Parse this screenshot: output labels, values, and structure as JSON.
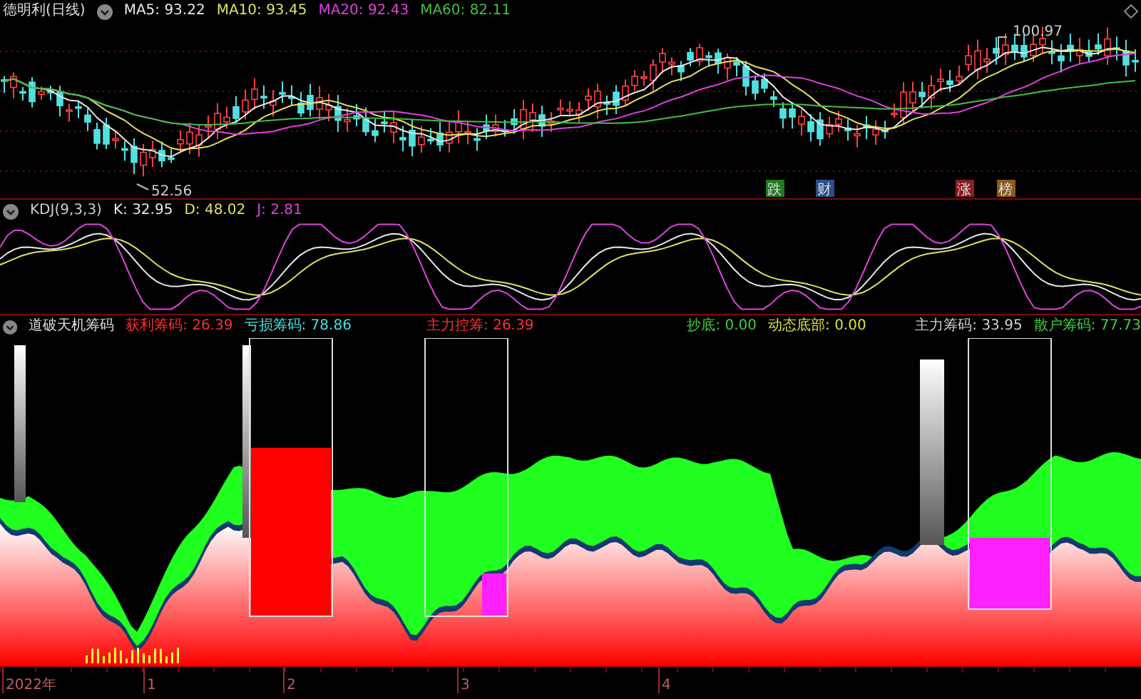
{
  "price_panel": {
    "title": "德明利(日线)",
    "indicators": [
      {
        "label": "MA5: 93.22",
        "color": "#e8e8e8"
      },
      {
        "label": "MA10: 93.45",
        "color": "#e0e060"
      },
      {
        "label": "MA20: 92.43",
        "color": "#e040e0"
      },
      {
        "label": "MA60: 82.11",
        "color": "#40c040"
      }
    ],
    "high_label": "100.97",
    "low_label": "52.56",
    "event_tags": [
      {
        "text": "跌",
        "color": "#1f7a1f"
      },
      {
        "text": "财",
        "color": "#2a4f8a"
      },
      {
        "text": "涨",
        "color": "#8a1f1f"
      },
      {
        "text": "榜",
        "color": "#8a5a1f"
      }
    ]
  },
  "kdj_panel": {
    "title": "KDJ(9,3,3)",
    "indicators": [
      {
        "label": "K: 32.95",
        "color": "#e8e8e8"
      },
      {
        "label": "D: 48.02",
        "color": "#e0e060"
      },
      {
        "label": "J: 2.81",
        "color": "#e040e0"
      }
    ]
  },
  "chip_panel": {
    "title": "道破天机筹码",
    "indicators": [
      {
        "label": "获利筹码: 26.39",
        "color": "#ff3030"
      },
      {
        "label": "亏损筹码: 78.86",
        "color": "#40e0e0"
      },
      {
        "label": "主力控筹: 26.39",
        "color": "#ff3030"
      },
      {
        "label": "抄底: 0.00",
        "color": "#40d040"
      },
      {
        "label": "动态底部: 0.00",
        "color": "#e0e040"
      },
      {
        "label": "主力筹码: 33.95",
        "color": "#d0d0d0"
      },
      {
        "label": "散户筹码: 77.73",
        "color": "#40d040"
      }
    ]
  },
  "x_axis": [
    "2022年",
    "1",
    "2",
    "3",
    "4"
  ]
}
